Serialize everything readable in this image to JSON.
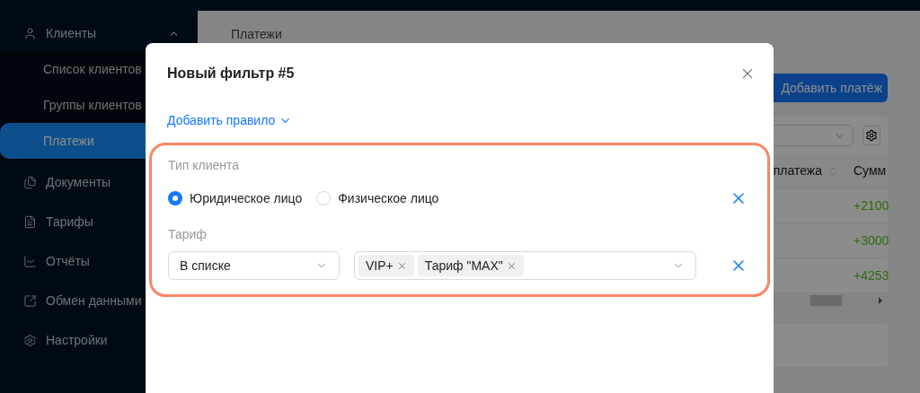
{
  "sidebar": {
    "items": [
      {
        "label": "Клиенты",
        "selected": false,
        "expanded": true,
        "children": [
          {
            "label": "Список клиентов",
            "selected": false
          },
          {
            "label": "Группы клиентов",
            "selected": false
          },
          {
            "label": "Платежи",
            "selected": true
          }
        ]
      },
      {
        "label": "Документы",
        "selected": false
      },
      {
        "label": "Тарифы",
        "selected": false
      },
      {
        "label": "Отчёты",
        "selected": false
      },
      {
        "label": "Обмен данными",
        "selected": false
      },
      {
        "label": "Настройки",
        "selected": false
      }
    ]
  },
  "page": {
    "breadcrumb": "Платежи",
    "add_button": "Добавить платёж",
    "table": {
      "columns": [
        {
          "label": "платежа",
          "sortable": true
        },
        {
          "label": "Сумм"
        }
      ],
      "rows": [
        {
          "amount": "+2100"
        },
        {
          "amount": "+3000"
        },
        {
          "amount": "+4253"
        }
      ]
    }
  },
  "modal": {
    "title": "Новый фильтр #5",
    "add_rule": "Добавить правило",
    "rules": [
      {
        "kind": "radio",
        "label": "Тип клиента",
        "options": [
          {
            "label": "Юридическое лицо",
            "selected": true
          },
          {
            "label": "Физическое лицо",
            "selected": false
          }
        ]
      },
      {
        "kind": "select",
        "label": "Тариф",
        "operator": "В списке",
        "tags": [
          {
            "label": "VIP+"
          },
          {
            "label": "Тариф \"MAX\""
          }
        ]
      }
    ]
  }
}
